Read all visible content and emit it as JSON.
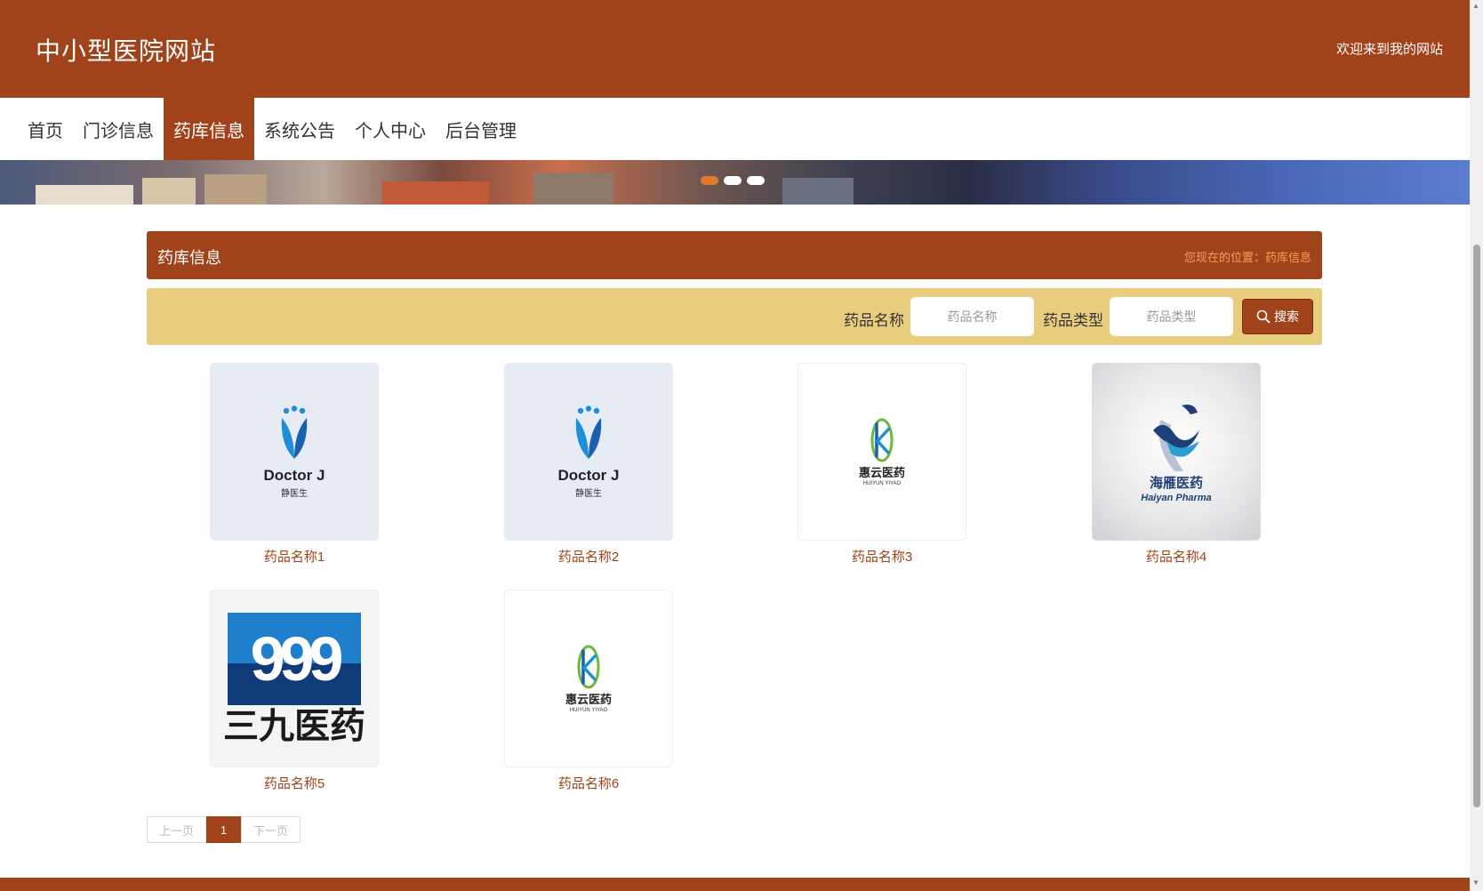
{
  "header": {
    "title": "中小型医院网站",
    "welcome": "欢迎来到我的网站"
  },
  "nav": {
    "items": [
      {
        "label": "首页"
      },
      {
        "label": "门诊信息"
      },
      {
        "label": "药库信息",
        "active": true
      },
      {
        "label": "系统公告"
      },
      {
        "label": "个人中心"
      },
      {
        "label": "后台管理"
      }
    ]
  },
  "section": {
    "title": "药库信息",
    "breadcrumb": "您现在的位置：药库信息"
  },
  "search": {
    "name_label": "药品名称",
    "name_placeholder": "药品名称",
    "type_label": "药品类型",
    "type_placeholder": "药品类型",
    "button_label": "搜索"
  },
  "drugs": [
    {
      "name": "药品名称1",
      "logo": {
        "brand": "Doctor J",
        "sub": "静医生"
      }
    },
    {
      "name": "药品名称2",
      "logo": {
        "brand": "Doctor J",
        "sub": "静医生"
      }
    },
    {
      "name": "药品名称3",
      "logo": {
        "brand": "惠云医药",
        "sub": "HUIYUN YIYAO"
      }
    },
    {
      "name": "药品名称4",
      "logo": {
        "brand": "海雁医药",
        "sub": "Haiyan Pharma"
      }
    },
    {
      "name": "药品名称5",
      "logo": {
        "brand": "999",
        "sub": "三九医药"
      }
    },
    {
      "name": "药品名称6",
      "logo": {
        "brand": "惠云医药",
        "sub": "HUIYUN YIYAO"
      }
    }
  ],
  "pagination": {
    "prev": "上一页",
    "current": "1",
    "next": "下一页"
  },
  "colors": {
    "brand": "#a0431b",
    "search_bar": "#e9cd7e",
    "link": "#a0431b"
  }
}
